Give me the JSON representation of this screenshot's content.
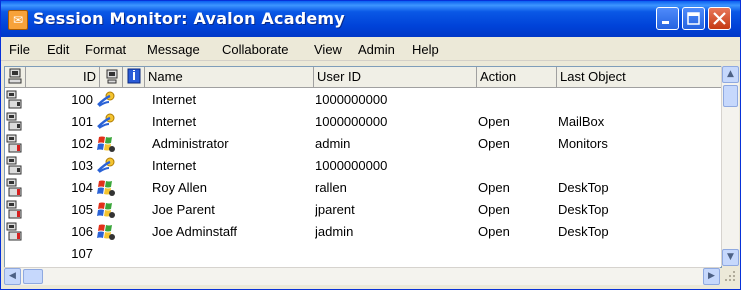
{
  "window": {
    "title": "Session Monitor: Avalon Academy"
  },
  "menu": [
    "File",
    "Edit",
    "Format",
    "Message",
    "Collaborate",
    "View",
    "Admin",
    "Help"
  ],
  "columns": {
    "id": "ID",
    "name": "Name",
    "user_id": "User ID",
    "action": "Action",
    "last_object": "Last Object"
  },
  "rows": [
    {
      "id": "100",
      "icon": "internet-user-icon",
      "name": "Internet",
      "user_id": "1000000000",
      "action": "",
      "last_object": ""
    },
    {
      "id": "101",
      "icon": "internet-user-icon",
      "name": "Internet",
      "user_id": "1000000000",
      "action": "Open",
      "last_object": "MailBox"
    },
    {
      "id": "102",
      "icon": "windows-user-icon",
      "name": "Administrator",
      "user_id": "admin",
      "action": "Open",
      "last_object": "Monitors"
    },
    {
      "id": "103",
      "icon": "internet-user-icon",
      "name": "Internet",
      "user_id": "1000000000",
      "action": "",
      "last_object": ""
    },
    {
      "id": "104",
      "icon": "windows-user-icon",
      "name": "Roy Allen",
      "user_id": "rallen",
      "action": "Open",
      "last_object": "DeskTop"
    },
    {
      "id": "105",
      "icon": "windows-user-icon",
      "name": "Joe Parent",
      "user_id": "jparent",
      "action": "Open",
      "last_object": "DeskTop"
    },
    {
      "id": "106",
      "icon": "windows-user-icon",
      "name": "Joe Adminstaff",
      "user_id": "jadmin",
      "action": "Open",
      "last_object": "DeskTop"
    },
    {
      "id": "107",
      "icon": "",
      "name": "",
      "user_id": "",
      "action": "",
      "last_object": ""
    }
  ],
  "colors": {
    "title_bar": "#0a58e6",
    "close_button": "#c53a14",
    "list_background": "#ffffff"
  }
}
